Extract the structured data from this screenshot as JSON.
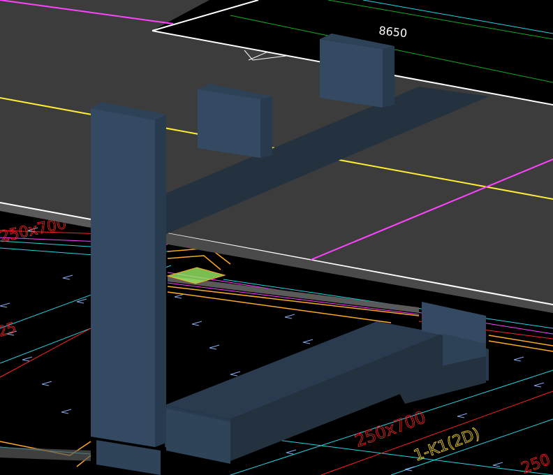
{
  "view": {
    "background": "#000000",
    "slab_color": "#3c3c3c",
    "slab_edge_color": "#5a5a5a",
    "beam_face_color": "#344a62",
    "beam_side_color": "#283a4e",
    "beam_shadow_color": "#24313f",
    "line_colors": {
      "white": "#ffffff",
      "magenta": "#ff44ff",
      "yellow": "#ffee33",
      "cyan": "#22d5e5",
      "orange": "#ffaa22",
      "red": "#ff2222",
      "green": "#11aa22",
      "blue_mark": "#88aaee",
      "highlight": "#99ee66"
    }
  },
  "labels": {
    "elevation": "8650",
    "beam_label_1": "250x700",
    "beam_label_2": "1-K1(2D)",
    "beam_label_3": "250",
    "beam_label_4": "250",
    "beam_label_5": "25"
  }
}
